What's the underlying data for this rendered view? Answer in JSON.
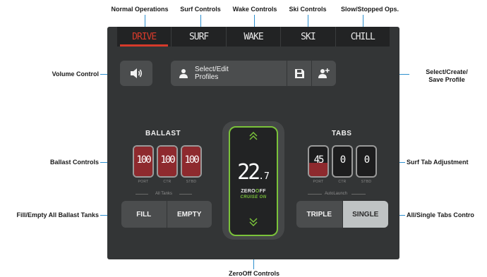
{
  "mode_tabs": [
    {
      "label": "DRIVE",
      "active": true
    },
    {
      "label": "SURF",
      "active": false
    },
    {
      "label": "WAKE",
      "active": false
    },
    {
      "label": "SKI",
      "active": false
    },
    {
      "label": "CHILL",
      "active": false
    }
  ],
  "volume": {
    "icon": "speaker-icon"
  },
  "profile": {
    "label": "Select/Edit Profiles",
    "save_icon": "floppy-disk-icon",
    "add_icon": "add-user-icon"
  },
  "ballast": {
    "title": "BALLAST",
    "tanks": [
      {
        "value": "100",
        "label": "PORT",
        "fill_fraction": 1.0
      },
      {
        "value": "100",
        "label": "CTR",
        "fill_fraction": 1.0
      },
      {
        "value": "100",
        "label": "STBD",
        "fill_fraction": 1.0
      }
    ],
    "group_label": "All Tanks",
    "buttons": {
      "fill": "FILL",
      "empty": "EMPTY"
    }
  },
  "tabs": {
    "title": "TABS",
    "tanks": [
      {
        "value": "45",
        "label": "PORT",
        "fill_fraction": 0.45
      },
      {
        "value": "0",
        "label": "CTR",
        "fill_fraction": 0
      },
      {
        "value": "0",
        "label": "STBD",
        "fill_fraction": 0
      }
    ],
    "group_label": "AutoLaunch",
    "buttons": {
      "triple": "TRIPLE",
      "single": "SINGLE"
    }
  },
  "zerooff": {
    "speed_int": "22",
    "speed_dec": ".7",
    "brand_a": "ZERO",
    "brand_o": "O",
    "brand_b": "FF",
    "status": "CRUISE ON",
    "accent": "#7ac23a"
  },
  "annotations": {
    "normal_ops": "Normal Operations",
    "surf_controls": "Surf Controls",
    "wake_controls": "Wake Controls",
    "ski_controls": "Ski Controls",
    "slow_ops": "Slow/Stopped Ops.",
    "volume_control": "Volume Control",
    "select_create_1": "Select/Create/",
    "select_create_2": "Save Profile",
    "ballast_controls": "Ballast Controls",
    "surf_tab_adjust": "Surf Tab Adjustment",
    "fill_empty": "Fill/Empty All Ballast Tanks",
    "all_single": "All/Single Tabs Contro",
    "zerooff_controls": "ZeroOff Controls"
  },
  "colors": {
    "accent_red": "#d63a2a",
    "accent_green": "#7ac23a",
    "leader_blue": "#2d8fce"
  }
}
